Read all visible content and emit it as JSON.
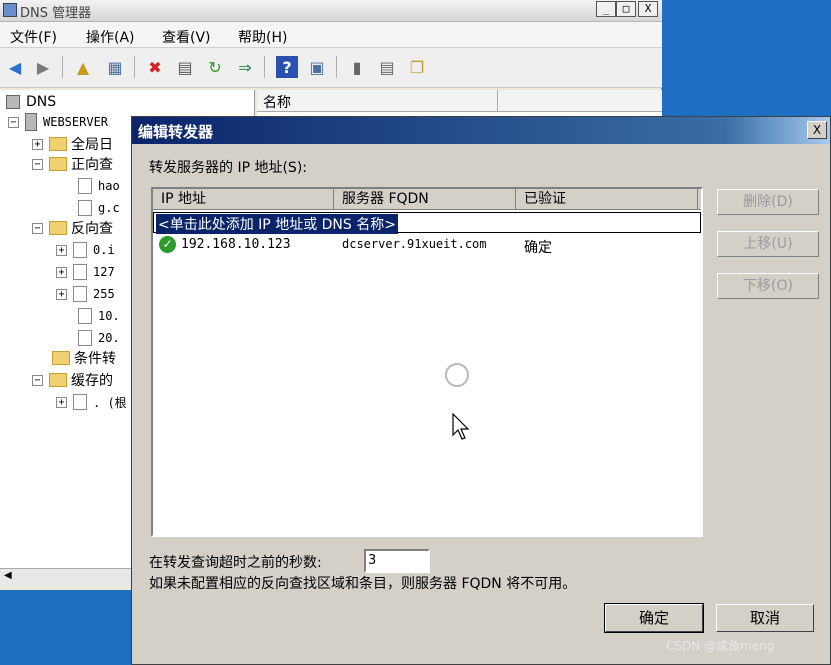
{
  "main_window": {
    "title": "DNS 管理器",
    "min_btn": "_",
    "max_btn": "□",
    "close_btn": "X"
  },
  "menu": [
    "文件(F)",
    "操作(A)",
    "查看(V)",
    "帮助(H)"
  ],
  "toolbar_icons": [
    "back-icon",
    "forward-icon",
    "up-folder-icon",
    "show-hide-tree-icon",
    "delete-icon",
    "properties-icon",
    "refresh-icon",
    "export-list-icon",
    "help-icon",
    "console-icon",
    "server-icon",
    "list-icon",
    "copy-icon"
  ],
  "tree": {
    "root": "DNS",
    "server": "WEBSERVER",
    "items": [
      "全局日",
      "正向查",
      "hao",
      "g.c",
      "反向查",
      "0.i",
      "127",
      "255",
      "10.",
      "20.",
      "条件转",
      "缓存的",
      ". (根"
    ]
  },
  "list_pane": {
    "header": "名称"
  },
  "dialog": {
    "title": "编辑转发器",
    "close": "X",
    "servers_label": "转发服务器的 IP 地址(S):",
    "columns": [
      "IP 地址",
      "服务器 FQDN",
      "已验证"
    ],
    "add_placeholder": "<单击此处添加 IP 地址或 DNS 名称>",
    "rows": [
      {
        "ip": "192.168.10.123",
        "fqdn": "dcserver.91xueit.com",
        "verified": "确定",
        "status_icon": "check-icon"
      }
    ],
    "buttons_side": {
      "delete": "删除(D)",
      "up": "上移(U)",
      "down": "下移(O)"
    },
    "timeout_label": "在转发查询超时之前的秒数:",
    "timeout_value": "3",
    "note": "如果未配置相应的反向查找区域和条目，则服务器 FQDN 将不可用。",
    "ok": "确定",
    "cancel": "取消"
  },
  "watermark": "CSDN @咸鱼meng"
}
